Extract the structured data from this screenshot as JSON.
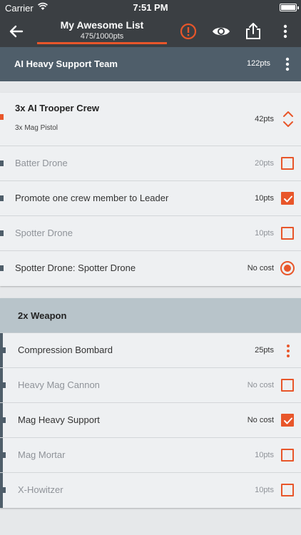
{
  "status_bar": {
    "carrier": "Carrier",
    "time": "7:51 PM"
  },
  "app_bar": {
    "title": "My Awesome List",
    "subtitle": "475/1000pts",
    "accent_color": "#e8562a"
  },
  "section": {
    "name": "AI Heavy Support Team",
    "pts": "122pts"
  },
  "crew": {
    "name": "3x AI Trooper Crew",
    "sub": "3x Mag Pistol",
    "pts": "42pts"
  },
  "options": [
    {
      "label": "Batter Drone",
      "pts": "20pts",
      "control": "checkbox",
      "checked": false,
      "dim": true
    },
    {
      "label": "Promote one crew member to Leader",
      "pts": "10pts",
      "control": "checkbox",
      "checked": true,
      "dim": false
    },
    {
      "label": "Spotter Drone",
      "pts": "10pts",
      "control": "checkbox",
      "checked": false,
      "dim": true
    },
    {
      "label": "Spotter Drone: Spotter Drone",
      "pts": "No cost",
      "control": "radio",
      "checked": true,
      "dim": false
    }
  ],
  "weapon_group": {
    "name": "2x Weapon",
    "items": [
      {
        "label": "Compression Bombard",
        "pts": "25pts",
        "control": "more",
        "dim": false
      },
      {
        "label": "Heavy Mag Cannon",
        "pts": "No cost",
        "control": "checkbox",
        "checked": false,
        "dim": true
      },
      {
        "label": "Mag Heavy Support",
        "pts": "No cost",
        "control": "checkbox",
        "checked": true,
        "dim": false
      },
      {
        "label": "Mag Mortar",
        "pts": "10pts",
        "control": "checkbox",
        "checked": false,
        "dim": true
      },
      {
        "label": "X-Howitzer",
        "pts": "10pts",
        "control": "checkbox",
        "checked": false,
        "dim": true
      }
    ]
  }
}
